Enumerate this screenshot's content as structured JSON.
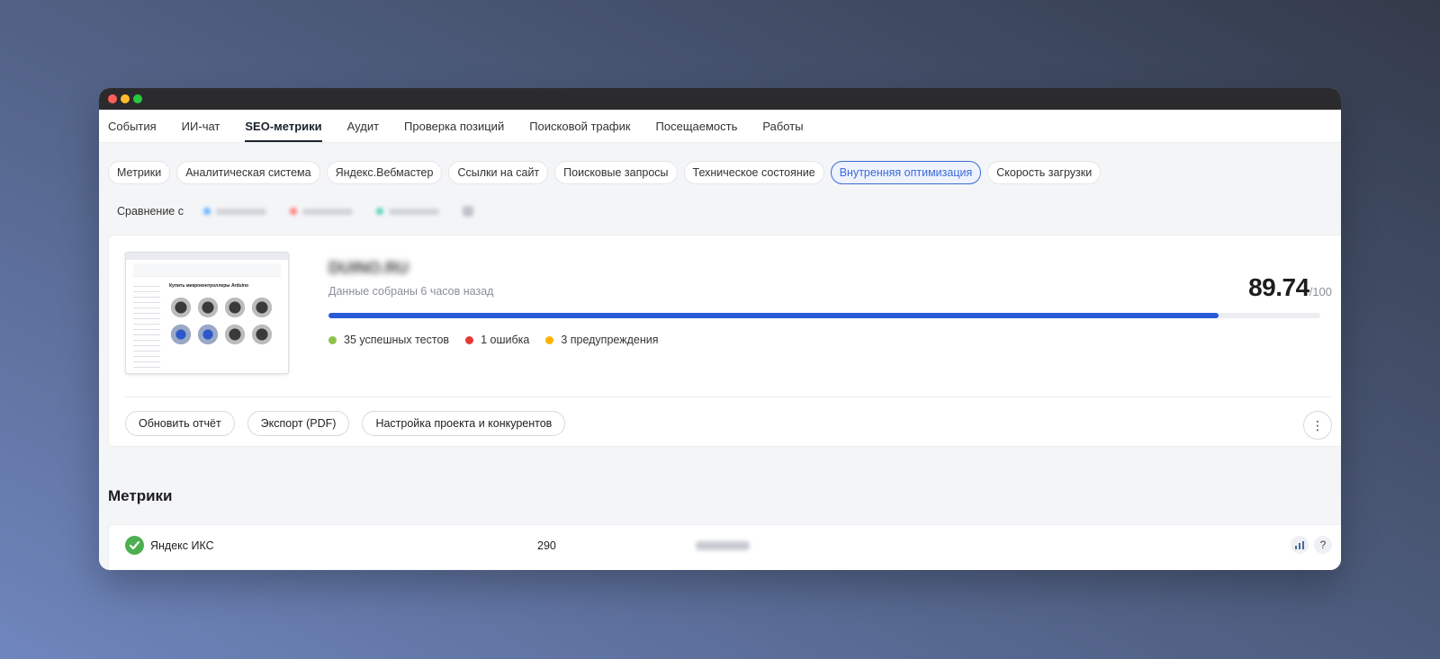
{
  "tabs": [
    "События",
    "ИИ-чат",
    "SEO-метрики",
    "Аудит",
    "Проверка позиций",
    "Поисковой трафик",
    "Посещаемость",
    "Работы"
  ],
  "active_tab": "SEO-метрики",
  "subtabs": [
    "Метрики",
    "Аналитическая система",
    "Яндекс.Вебмастер",
    "Ссылки на сайт",
    "Поисковые запросы",
    "Техническое состояние",
    "Внутренняя оптимизация",
    "Скорость загрузки"
  ],
  "active_subtab": "Внутренняя оптимизация",
  "compare": {
    "label": "Сравнение с",
    "competitor_colors": [
      "#4ea8ff",
      "#ff6b6b",
      "#3fd0b0"
    ]
  },
  "thumbnail": {
    "title": "Купить микроконтроллеры Arduino"
  },
  "report": {
    "site_name": "DUINO.RU",
    "collected": "Данные собраны 6 часов назад",
    "score": "89.74",
    "score_max": "/100",
    "progress": 0.8974,
    "tests": [
      {
        "label": "35 успешных тестов",
        "color": "#8bc34a"
      },
      {
        "label": "1 ошибка",
        "color": "#e53935"
      },
      {
        "label": "3 предупреждения",
        "color": "#ffb300"
      }
    ],
    "actions": {
      "refresh": "Обновить отчёт",
      "export": "Экспорт (PDF)",
      "settings": "Настройка проекта и конкурентов"
    },
    "more_icon": "⋮"
  },
  "metrics": {
    "title": "Метрики",
    "rows": [
      {
        "name": "Яндекс ИКС",
        "value": "290"
      }
    ]
  },
  "colors": {
    "accent": "#2a5bd7",
    "active_chip": "#3b6bd6",
    "success": "#4caf50"
  },
  "icons": [
    "check-icon",
    "chart-icon",
    "help-icon",
    "more-vertical-icon"
  ]
}
